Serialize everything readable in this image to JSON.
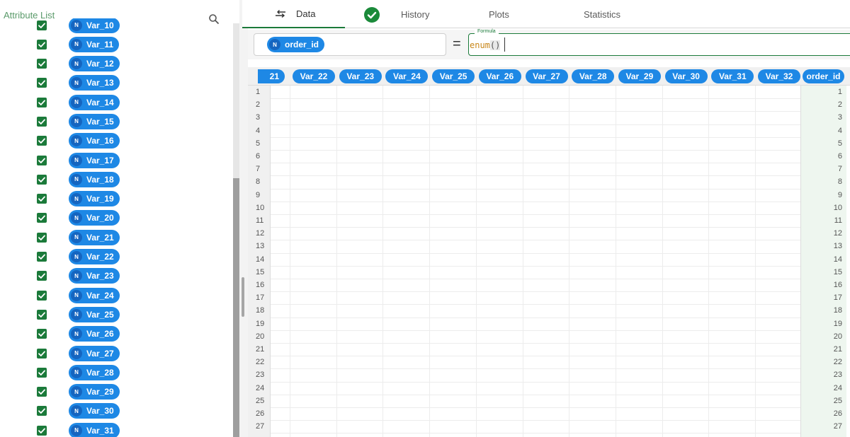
{
  "left_panel": {
    "title": "Attribute List",
    "search_icon": "search-icon",
    "items": [
      {
        "label": "Var_10",
        "badge": "N",
        "checked": true
      },
      {
        "label": "Var_11",
        "badge": "N",
        "checked": true
      },
      {
        "label": "Var_12",
        "badge": "N",
        "checked": true
      },
      {
        "label": "Var_13",
        "badge": "N",
        "checked": true
      },
      {
        "label": "Var_14",
        "badge": "N",
        "checked": true
      },
      {
        "label": "Var_15",
        "badge": "N",
        "checked": true
      },
      {
        "label": "Var_16",
        "badge": "N",
        "checked": true
      },
      {
        "label": "Var_17",
        "badge": "N",
        "checked": true
      },
      {
        "label": "Var_18",
        "badge": "N",
        "checked": true
      },
      {
        "label": "Var_19",
        "badge": "N",
        "checked": true
      },
      {
        "label": "Var_20",
        "badge": "N",
        "checked": true
      },
      {
        "label": "Var_21",
        "badge": "N",
        "checked": true
      },
      {
        "label": "Var_22",
        "badge": "N",
        "checked": true
      },
      {
        "label": "Var_23",
        "badge": "N",
        "checked": true
      },
      {
        "label": "Var_24",
        "badge": "N",
        "checked": true
      },
      {
        "label": "Var_25",
        "badge": "N",
        "checked": true
      },
      {
        "label": "Var_26",
        "badge": "N",
        "checked": true
      },
      {
        "label": "Var_27",
        "badge": "N",
        "checked": true
      },
      {
        "label": "Var_28",
        "badge": "N",
        "checked": true
      },
      {
        "label": "Var_29",
        "badge": "N",
        "checked": true
      },
      {
        "label": "Var_30",
        "badge": "N",
        "checked": true
      },
      {
        "label": "Var_31",
        "badge": "N",
        "checked": true
      }
    ]
  },
  "tabs": {
    "data": "Data",
    "history": "History",
    "plots": "Plots",
    "statistics": "Statistics"
  },
  "formula": {
    "attribute": "order_id",
    "attribute_badge": "N",
    "equals": "=",
    "legend": "Formula",
    "func": "enum",
    "parens": "()"
  },
  "grid": {
    "partial_column": "21",
    "columns": [
      "Var_22",
      "Var_23",
      "Var_24",
      "Var_25",
      "Var_26",
      "Var_27",
      "Var_28",
      "Var_29",
      "Var_30",
      "Var_31",
      "Var_32"
    ],
    "order_column": "order_id",
    "row_numbers": [
      "1",
      "2",
      "3",
      "4",
      "5",
      "6",
      "7",
      "8",
      "9",
      "10",
      "11",
      "12",
      "13",
      "14",
      "15",
      "16",
      "17",
      "18",
      "19",
      "20",
      "21",
      "22",
      "23",
      "24",
      "25",
      "26",
      "27"
    ],
    "order_values": [
      "1",
      "2",
      "3",
      "4",
      "5",
      "6",
      "7",
      "8",
      "9",
      "10",
      "11",
      "12",
      "13",
      "14",
      "15",
      "16",
      "17",
      "18",
      "19",
      "20",
      "21",
      "22",
      "23",
      "24",
      "25",
      "26",
      "27"
    ]
  },
  "colors": {
    "accent_green": "#1b7a3a",
    "pill_blue": "#1e88e5",
    "badge_blue": "#1565c0"
  }
}
